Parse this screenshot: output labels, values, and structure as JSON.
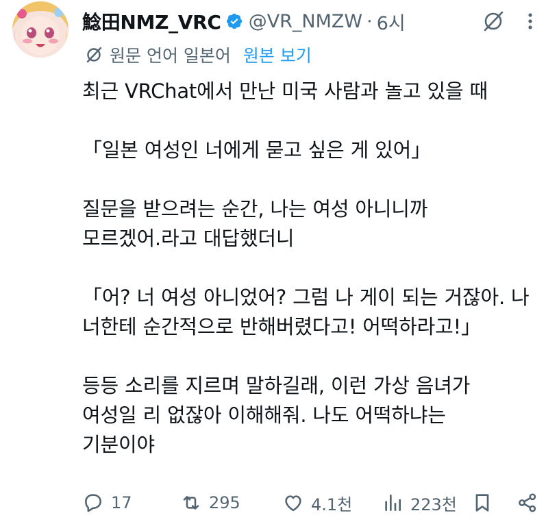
{
  "author": {
    "display_name": "鯰田NMZ_VRC",
    "handle": "@VR_NMZW",
    "separator": "·",
    "time": "6시"
  },
  "translation": {
    "label": "원문 언어 일본어",
    "show_original": "원본 보기"
  },
  "tweet": {
    "paragraphs": [
      [
        "최근 VRChat에서 만난 미국 사람과 놀고 있을 때"
      ],
      [
        "「일본 여성인 너에게 묻고 싶은 게 있어」"
      ],
      [
        "질문을 받으려는 순간, 나는 여성 아니니까",
        "모르겠어.라고 대답했더니"
      ],
      [
        "「어? 너 여성 아니었어? 그럼 나 게이 되는 거잖아. 나",
        "너한테 순간적으로 반해버렸다고! 어떡하라고!」"
      ],
      [
        "등등 소리를 지르며 말하길래, 이런 가상 음녀가",
        "여성일 리 없잖아 이해해줘. 나도 어떡하냐는",
        "기분이야"
      ]
    ]
  },
  "actions": {
    "replies": "17",
    "retweets": "295",
    "likes": "4.1천",
    "views": "223천"
  },
  "colors": {
    "text": "#0f1419",
    "secondary": "#536471",
    "link": "#1d9bf0",
    "verified": "#1d9bf0"
  },
  "icons": {
    "verified": "verified-badge-icon",
    "grok": "grok-icon",
    "more": "more-icon",
    "translate": "translate-icon",
    "reply": "reply-icon",
    "retweet": "retweet-icon",
    "like": "heart-icon",
    "views": "views-icon",
    "bookmark": "bookmark-icon",
    "share": "share-icon"
  }
}
